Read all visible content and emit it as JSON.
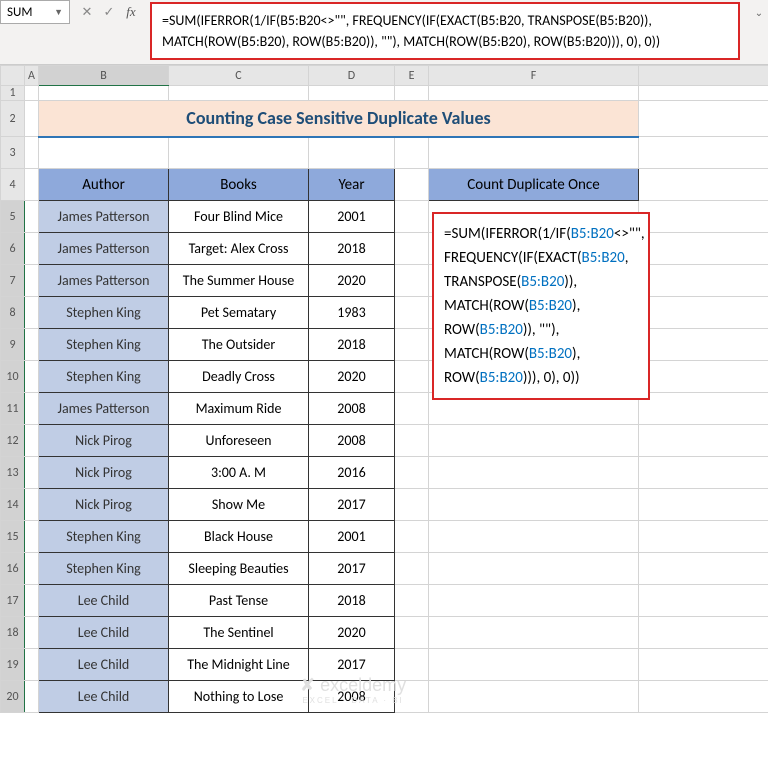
{
  "nameBox": "SUM",
  "formulaBarText": "=SUM(IFERROR(1/IF(B5:B20<>\"\", FREQUENCY(IF(EXACT(B5:B20, TRANSPOSE(B5:B20)), MATCH(ROW(B5:B20), ROW(B5:B20)), \"\"), MATCH(ROW(B5:B20), ROW(B5:B20))), 0), 0))",
  "colHeads": {
    "A": "A",
    "B": "B",
    "C": "C",
    "D": "D",
    "E": "E",
    "F": "F"
  },
  "title": "Counting Case Sensitive Duplicate Values",
  "table": {
    "headers": {
      "author": "Author",
      "books": "Books",
      "year": "Year"
    },
    "rows": [
      {
        "author": "James Patterson",
        "book": "Four Blind Mice",
        "year": "2001"
      },
      {
        "author": "James Patterson",
        "book": "Target: Alex Cross",
        "year": "2018"
      },
      {
        "author": "James Patterson",
        "book": "The Summer House",
        "year": "2020"
      },
      {
        "author": "Stephen King",
        "book": "Pet Sematary",
        "year": "1983"
      },
      {
        "author": "Stephen King",
        "book": "The Outsider",
        "year": "2018"
      },
      {
        "author": "Stephen King",
        "book": "Deadly Cross",
        "year": "2020"
      },
      {
        "author": "James Patterson",
        "book": "Maximum Ride",
        "year": "2008"
      },
      {
        "author": "Nick Pirog",
        "book": "Unforeseen",
        "year": "2008"
      },
      {
        "author": "Nick Pirog",
        "book": "3:00 A. M",
        "year": "2016"
      },
      {
        "author": "Nick Pirog",
        "book": "Show Me",
        "year": "2017"
      },
      {
        "author": "Stephen King",
        "book": "Black House",
        "year": "2001"
      },
      {
        "author": "Stephen King",
        "book": "Sleeping Beauties",
        "year": "2017"
      },
      {
        "author": "Lee Child",
        "book": "Past Tense",
        "year": "2018"
      },
      {
        "author": "Lee Child",
        "book": "The Sentinel",
        "year": "2020"
      },
      {
        "author": "Lee Child",
        "book": "The Midnight Line",
        "year": "2017"
      },
      {
        "author": "Lee Child",
        "book": "Nothing to Lose",
        "year": "2008"
      }
    ]
  },
  "countBox": {
    "header": "Count Duplicate Once",
    "parts": {
      "p1": "=SUM(IFERROR(1/IF(",
      "p2": "B5:B20",
      "p3": "<>\"\", FREQUENCY(IF(EXACT(",
      "p4": "B5:B20",
      "p5": ", TRANSPOSE(",
      "p6": "B5:B20",
      "p7": ")), MATCH(ROW(",
      "p8": "B5:B20",
      "p9": "), ROW(",
      "p10": "B5:B20",
      "p11": ")), \"\"), MATCH(ROW(",
      "p12": "B5:B20",
      "p13": "), ROW(",
      "p14": "B5:B20",
      "p15": "))), 0), 0))"
    }
  },
  "watermark": {
    "main": "✘ exceldemy",
    "sub": "EXCEL · DATA · BI"
  }
}
